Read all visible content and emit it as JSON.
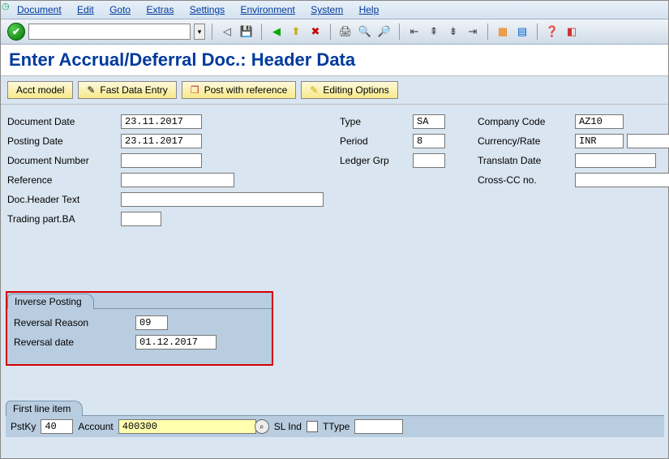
{
  "menu": {
    "document": "Document",
    "edit": "Edit",
    "goto": "Goto",
    "extras": "Extras",
    "settings": "Settings",
    "environment": "Environment",
    "system": "System",
    "help": "Help"
  },
  "title": "Enter Accrual/Deferral Doc.: Header Data",
  "appbuttons": {
    "acct_model": "Acct model",
    "fast_entry": "Fast Data Entry",
    "post_ref": "Post with reference",
    "edit_opts": "Editing Options"
  },
  "labels": {
    "doc_date": "Document Date",
    "post_date": "Posting Date",
    "doc_num": "Document Number",
    "reference": "Reference",
    "header_txt": "Doc.Header Text",
    "trading": "Trading part.BA",
    "type": "Type",
    "period": "Period",
    "ledger": "Ledger Grp",
    "company": "Company Code",
    "currency": "Currency/Rate",
    "transdate": "Translatn Date",
    "crosscc": "Cross-CC no.",
    "inverse_posting": "Inverse Posting",
    "rev_reason": "Reversal Reason",
    "rev_date": "Reversal date",
    "first_line": "First line item",
    "pstky": "PstKy",
    "account": "Account",
    "slind": "SL Ind",
    "ttype": "TType"
  },
  "values": {
    "doc_date": "23.11.2017",
    "post_date": "23.11.2017",
    "doc_num": "",
    "reference": "",
    "header_txt": "",
    "trading": "",
    "type": "SA",
    "period": "8",
    "ledger": "",
    "company": "AZ10",
    "currency": "INR",
    "rate": "",
    "transdate": "",
    "crosscc": "",
    "rev_reason": "09",
    "rev_date": "01.12.2017",
    "pstky": "40",
    "account": "400300",
    "slind": "",
    "ttype": ""
  }
}
